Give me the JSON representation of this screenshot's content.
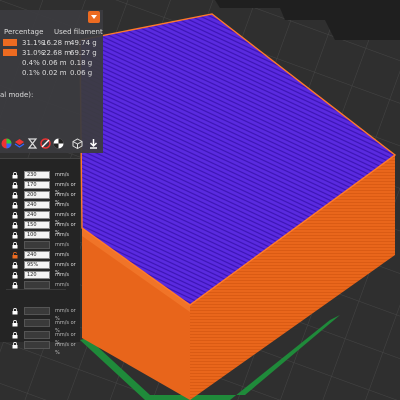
{
  "stats": {
    "headers": {
      "percentage": "Percentage",
      "used_filament": "Used filament"
    },
    "rows": [
      {
        "percent": "31.1%",
        "length": "16.28 m",
        "weight": "49.74 g",
        "swatch": true
      },
      {
        "percent": "31.0%",
        "length": "22.68 m",
        "weight": "69.27 g",
        "swatch": true
      },
      {
        "percent": "0.4%",
        "length": "0.06 m",
        "weight": "0.18 g",
        "swatch": false
      },
      {
        "percent": "0.1%",
        "length": "0.02 m",
        "weight": "0.06 g",
        "swatch": false
      }
    ],
    "note": "al mode):",
    "accent": "#ed6b21"
  },
  "toolbar_icons": [
    "color-wheel-icon",
    "layers-icon",
    "hourglass-icon",
    "filament-icon",
    "pie-icon",
    "cube-icon",
    "export-icon"
  ],
  "settings": {
    "rows": [
      {
        "value": "230",
        "unit": "mm/s",
        "locked": true,
        "enabled": true
      },
      {
        "value": "170",
        "unit": "mm/s or %",
        "locked": true,
        "enabled": true
      },
      {
        "value": "200",
        "unit": "mm/s or %",
        "locked": true,
        "enabled": true
      },
      {
        "value": "240",
        "unit": "mm/s",
        "locked": true,
        "enabled": true
      },
      {
        "value": "240",
        "unit": "mm/s or %",
        "locked": true,
        "enabled": true
      },
      {
        "value": "150",
        "unit": "mm/s or %",
        "locked": true,
        "enabled": true
      },
      {
        "value": "100",
        "unit": "mm/s",
        "locked": true,
        "enabled": true
      },
      {
        "value": "",
        "unit": "mm/s",
        "locked": true,
        "enabled": false
      },
      {
        "value": "240",
        "unit": "mm/s",
        "locked": false,
        "enabled": true
      },
      {
        "value": "95%",
        "unit": "mm/s or %",
        "locked": true,
        "enabled": true
      },
      {
        "value": "120",
        "unit": "mm/s",
        "locked": true,
        "enabled": true
      },
      {
        "value": "",
        "unit": "mm/s",
        "locked": true,
        "enabled": false
      },
      {
        "value": "",
        "unit": "mm/s or %",
        "locked": true,
        "enabled": false
      },
      {
        "value": "",
        "unit": "mm/s or %",
        "locked": true,
        "enabled": false
      },
      {
        "value": "",
        "unit": "mm/s or %",
        "locked": true,
        "enabled": false
      },
      {
        "value": "",
        "unit": "mm/s or %",
        "locked": true,
        "enabled": false
      }
    ]
  },
  "viewport": {
    "top_face_color": "#4f1fd0",
    "side_color": "#ea6a1c",
    "perimeter_color": "#ff7a2a",
    "bed_color": "#363636"
  }
}
